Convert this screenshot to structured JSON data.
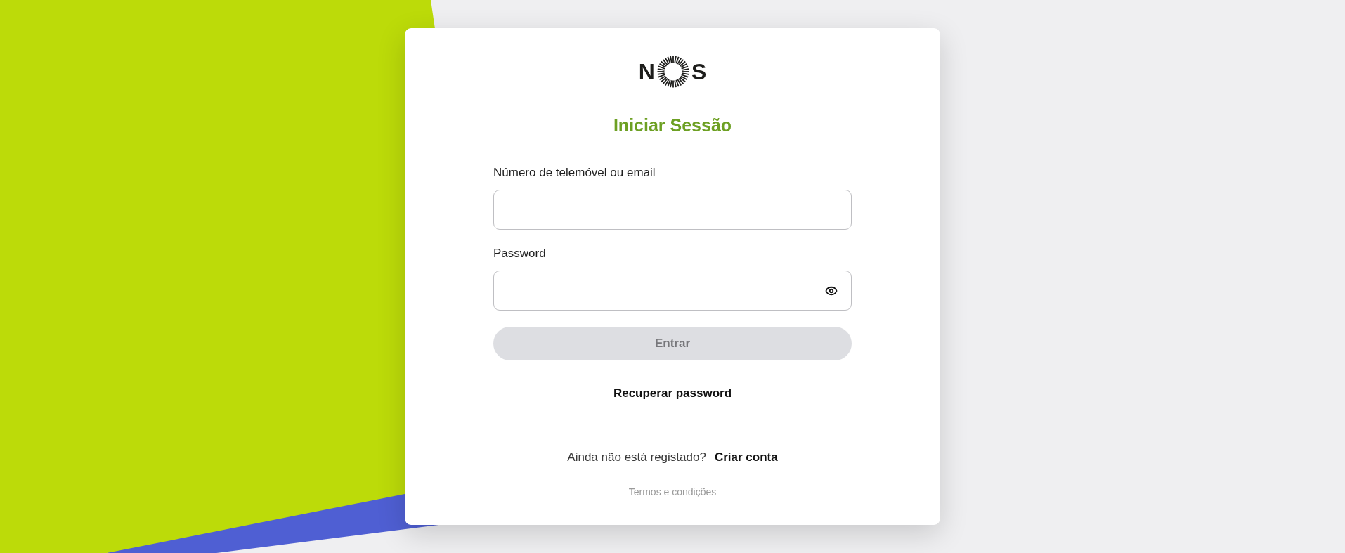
{
  "logo": {
    "letters": [
      "N",
      "S"
    ]
  },
  "title": "Iniciar Sessão",
  "fields": [
    {
      "kind": "text",
      "label": "Número de telemóvel ou email"
    },
    {
      "kind": "password",
      "label": "Password"
    }
  ],
  "submit_button": {
    "label": "Entrar",
    "disabled": true
  },
  "recover_link": "Recuperar password",
  "signup": {
    "prompt": "Ainda não está registado?",
    "link": "Criar conta"
  },
  "terms_link": "Termos e condições"
}
